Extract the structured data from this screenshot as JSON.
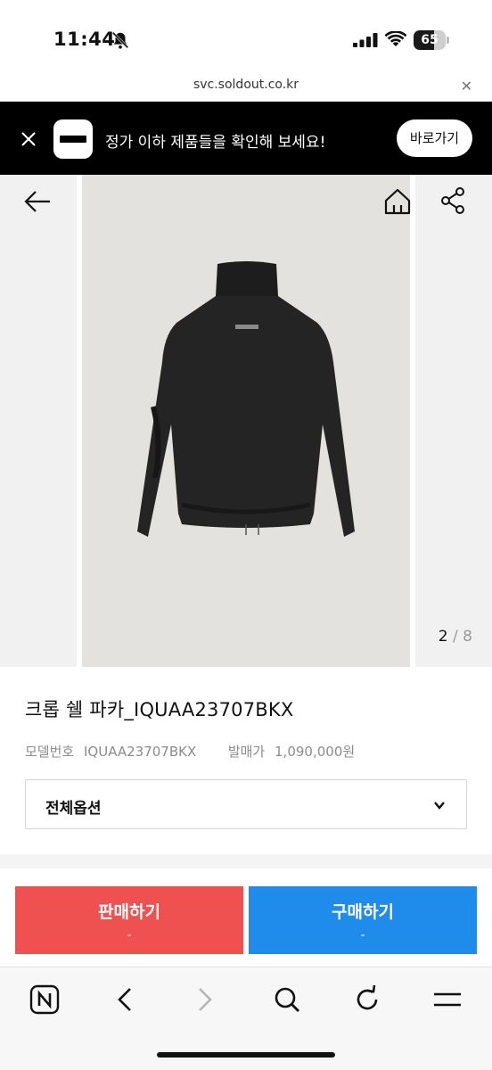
{
  "status": {
    "time": "11:44",
    "battery": "65",
    "battery_level": 0.65
  },
  "browser": {
    "url": "svc.soldout.co.kr"
  },
  "banner": {
    "message": "정가 이하 제품들을 확인해 보세요!",
    "button": "바로가기"
  },
  "gallery": {
    "current": "2",
    "separator": "/",
    "total": "8"
  },
  "product": {
    "title": "크롭 쉘 파카_IQUAA23707BKX",
    "model_label": "모델번호",
    "model_value": "IQUAA23707BKX",
    "release_label": "발매가",
    "release_value": "1,090,000원"
  },
  "option": {
    "label": "전체옵션"
  },
  "actions": {
    "sell_label": "판매하기",
    "sell_price": "-",
    "buy_label": "구매하기",
    "buy_price": "-"
  },
  "colors": {
    "sell": "#ef5050",
    "buy": "#1f8ceb",
    "banner": "#000000"
  },
  "icons": [
    "bell-slash-icon",
    "signal-icon",
    "wifi-icon",
    "battery-icon",
    "close-icon",
    "back-arrow-icon",
    "home-icon",
    "share-icon",
    "chevron-down-icon",
    "naver-icon",
    "browser-back-icon",
    "browser-forward-icon",
    "search-icon",
    "reload-icon",
    "menu-icon"
  ]
}
